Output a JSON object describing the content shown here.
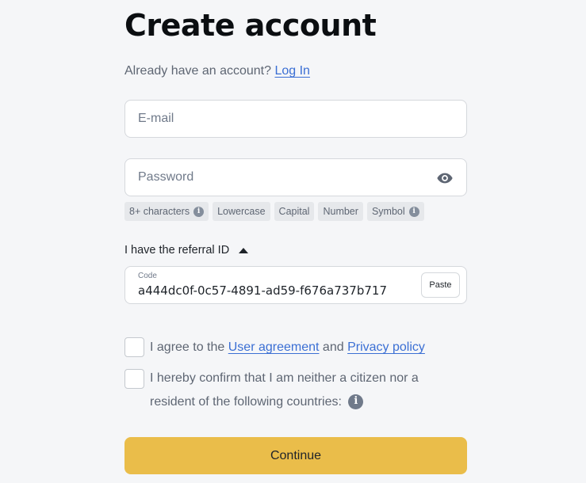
{
  "page": {
    "title": "Create account"
  },
  "login": {
    "prompt": "Already have an account?",
    "link_label": "Log In"
  },
  "email": {
    "placeholder": "E-mail",
    "value": ""
  },
  "password": {
    "placeholder": "Password",
    "value": "",
    "toggle_icon": "eye-icon"
  },
  "password_requirements": [
    {
      "label": "8+ characters",
      "has_info": true
    },
    {
      "label": "Lowercase",
      "has_info": false
    },
    {
      "label": "Capital",
      "has_info": false
    },
    {
      "label": "Number",
      "has_info": false
    },
    {
      "label": "Symbol",
      "has_info": true
    }
  ],
  "referral": {
    "toggle_label": "I have the referral ID",
    "code_label": "Code",
    "code_value": "a444dc0f-0c57-4891-ad59-f676a737b717",
    "paste_label": "Paste"
  },
  "agreements": {
    "terms": {
      "prefix": "I agree to the",
      "user_agreement": "User agreement",
      "and": "and",
      "privacy_policy": "Privacy policy"
    },
    "residency": {
      "text": "I hereby confirm that I am neither a citizen nor a resident of the following countries:"
    }
  },
  "continue_label": "Continue",
  "colors": {
    "background": "#f5f6f8",
    "accent_button": "#eabd4a",
    "link": "#3b6fd4"
  }
}
